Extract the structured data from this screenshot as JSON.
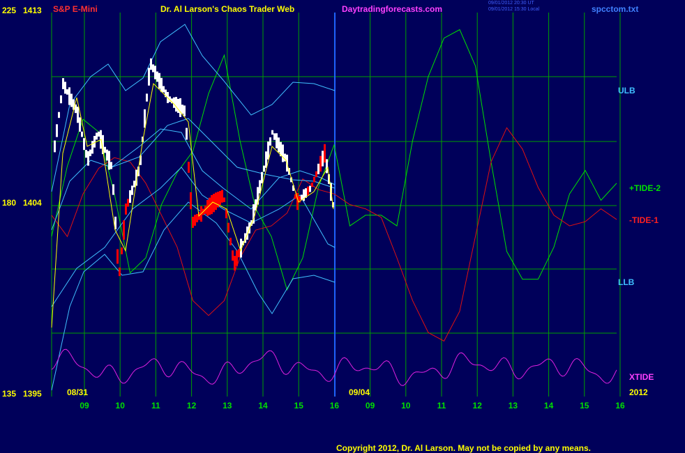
{
  "header": {
    "instrument": "S&P E-Mini",
    "title": "Dr. Al Larson's Chaos Trader Web",
    "site": "Daytradingforecasts.com",
    "timestamp1": "09/01/2012 20:30 UT",
    "timestamp2": "09/01/2012 15:30 Local",
    "filename": "spcctom.txt"
  },
  "y_axis_labels": [
    {
      "left": "225",
      "right": "1413"
    },
    {
      "left": "180",
      "right": "1404"
    },
    {
      "left": "135",
      "right": "1395"
    }
  ],
  "dates": {
    "start": "08/31",
    "split": "09/04",
    "year": "2012"
  },
  "copyright": "Copyright 2012, Dr. Al Larson. May not be copied by any means.",
  "colors": {
    "background": "#00005a",
    "grid": "#00a000",
    "price": "#ffffff",
    "price_down": "#ff0000",
    "ema": "#ffff00",
    "bands": "#40c0ff",
    "tide_plus": "#00e000",
    "tide_minus": "#e01010",
    "xtide": "#e020e0",
    "split_line": "#2060ff"
  },
  "chart_data": {
    "type": "line",
    "title": "S&P E-Mini",
    "x_tick_labels": [
      "09",
      "10",
      "11",
      "12",
      "13",
      "14",
      "15",
      "16",
      "09",
      "10",
      "11",
      "12",
      "13",
      "14",
      "15",
      "16"
    ],
    "ylim": [
      1395,
      1413
    ],
    "series_labels": {
      "ulb": "ULB",
      "tide2": "+TIDE-2",
      "tide1": "-TIDE-1",
      "llb": "LLB",
      "xtide": "XTIDE"
    },
    "series": [
      {
        "name": "+TIDE-2",
        "values": [
          1402.5,
          1405.8,
          1408.0,
          1407.4,
          1404.5,
          1400.8,
          1401.5,
          1404.0,
          1405.5,
          1406.5,
          1409.2,
          1411.0,
          1407.0,
          1403.8,
          1402.5,
          1400.0,
          1401.5,
          1404.8,
          1406.8,
          1403.0,
          1403.5,
          1403.5,
          1403.0,
          1407.0,
          1410.0,
          1411.8,
          1412.2,
          1410.5,
          1406.0,
          1401.8,
          1400.5,
          1400.5,
          1402.0,
          1404.5,
          1405.6,
          1404.2,
          1405.0
        ]
      },
      {
        "name": "-TIDE-1",
        "values": [
          1403.5,
          1402.5,
          1404.5,
          1405.7,
          1406.2,
          1406.0,
          1405.0,
          1403.5,
          1402.0,
          1399.5,
          1398.8,
          1399.5,
          1401.5,
          1402.8,
          1403.0,
          1403.6,
          1405.2,
          1404.7,
          1404.5,
          1404.0,
          1403.8,
          1403.4,
          1401.5,
          1399.5,
          1398.0,
          1397.6,
          1399.0,
          1402.5,
          1406.0,
          1407.6,
          1406.6,
          1404.8,
          1403.5,
          1403.0,
          1403.2,
          1403.8,
          1403.3
        ]
      }
    ]
  }
}
